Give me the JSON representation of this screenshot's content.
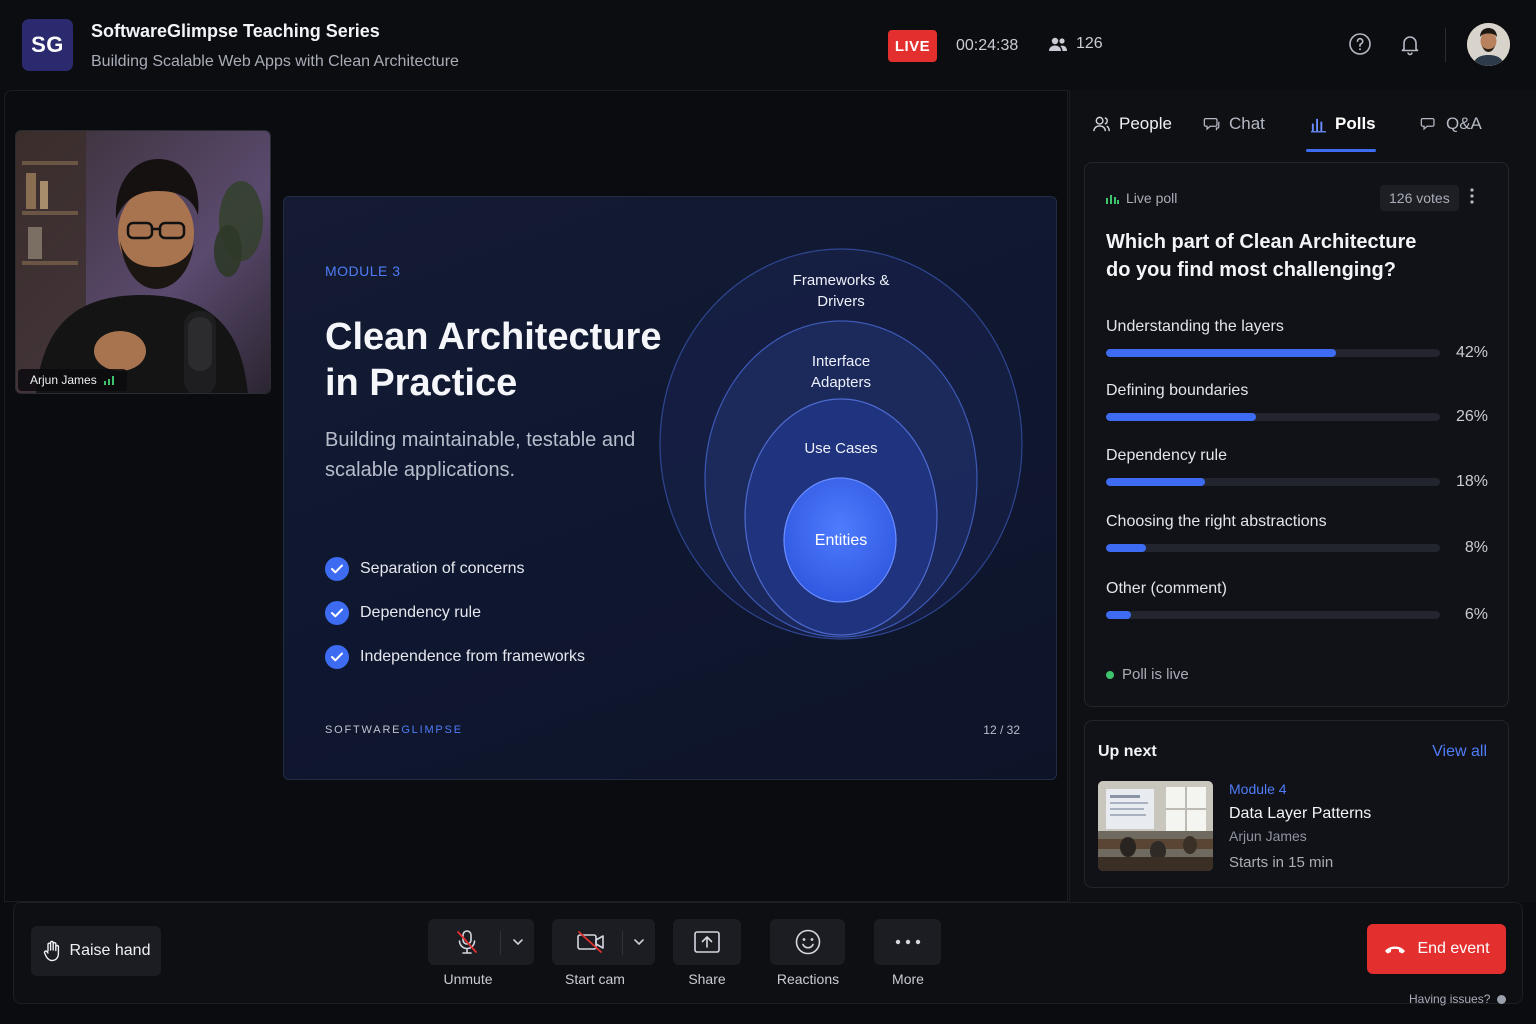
{
  "header": {
    "logo": "SG",
    "title": "SoftwareGlimpse Teaching Series",
    "subtitle": "Building Scalable Web Apps with Clean Architecture",
    "live_badge": "LIVE",
    "elapsed": "00:24:38",
    "viewer_count": "126",
    "icons": [
      "help-icon",
      "bell-icon"
    ]
  },
  "speaker": {
    "name": "Arjun James"
  },
  "slide": {
    "module": "MODULE 3",
    "title": "Clean Architecture in Practice",
    "subtitle": "Building maintainable, testable and scalable applications.",
    "bullets": [
      "Separation of concerns",
      "Dependency rule",
      "Independence from frameworks"
    ],
    "rings": {
      "outer": [
        "Frameworks &",
        "Drivers"
      ],
      "adapters": [
        "Interface",
        "Adapters"
      ],
      "use_cases": "Use Cases",
      "entities": "Entities"
    },
    "brand_a": "SOFTWARE",
    "brand_b": "GLIMPSE",
    "page": "12 / 32"
  },
  "panel": {
    "tabs": [
      {
        "label": "People",
        "icon": "people-icon"
      },
      {
        "label": "Chat",
        "icon": "chat-icon"
      },
      {
        "label": "Polls",
        "icon": "bar-chart-icon",
        "active": true
      },
      {
        "label": "Q&A",
        "icon": "qa-icon"
      }
    ],
    "poll": {
      "badge": "Live poll",
      "votes": "126 votes",
      "question": "Which part of Clean Architecture do you find most challenging?",
      "options": [
        {
          "label": "Understanding the layers",
          "pct": "42%",
          "value": 0.69
        },
        {
          "label": "Defining boundaries",
          "pct": "26%",
          "value": 0.45
        },
        {
          "label": "Dependency rule",
          "pct": "18%",
          "value": 0.295
        },
        {
          "label": "Choosing the right abstractions",
          "pct": "8%",
          "value": 0.12
        },
        {
          "label": "Other (comment)",
          "pct": "6%",
          "value": 0.075
        }
      ],
      "status": "Poll is live"
    },
    "up_next": {
      "title": "Up next",
      "view_all": "View all",
      "module": "Module 4",
      "name": "Data Layer Patterns",
      "host": "Arjun James",
      "starts": "Starts in 15 min"
    }
  },
  "controls": {
    "raise_hand": "Raise hand",
    "unmute": "Unmute",
    "start_cam": "Start cam",
    "share": "Share",
    "reactions": "Reactions",
    "more": "More",
    "end": "End event",
    "issues": "Having issues?"
  },
  "colors": {
    "accent": "#3d6cf2",
    "live": "#e3302f",
    "status_green": "#3ec46d"
  }
}
